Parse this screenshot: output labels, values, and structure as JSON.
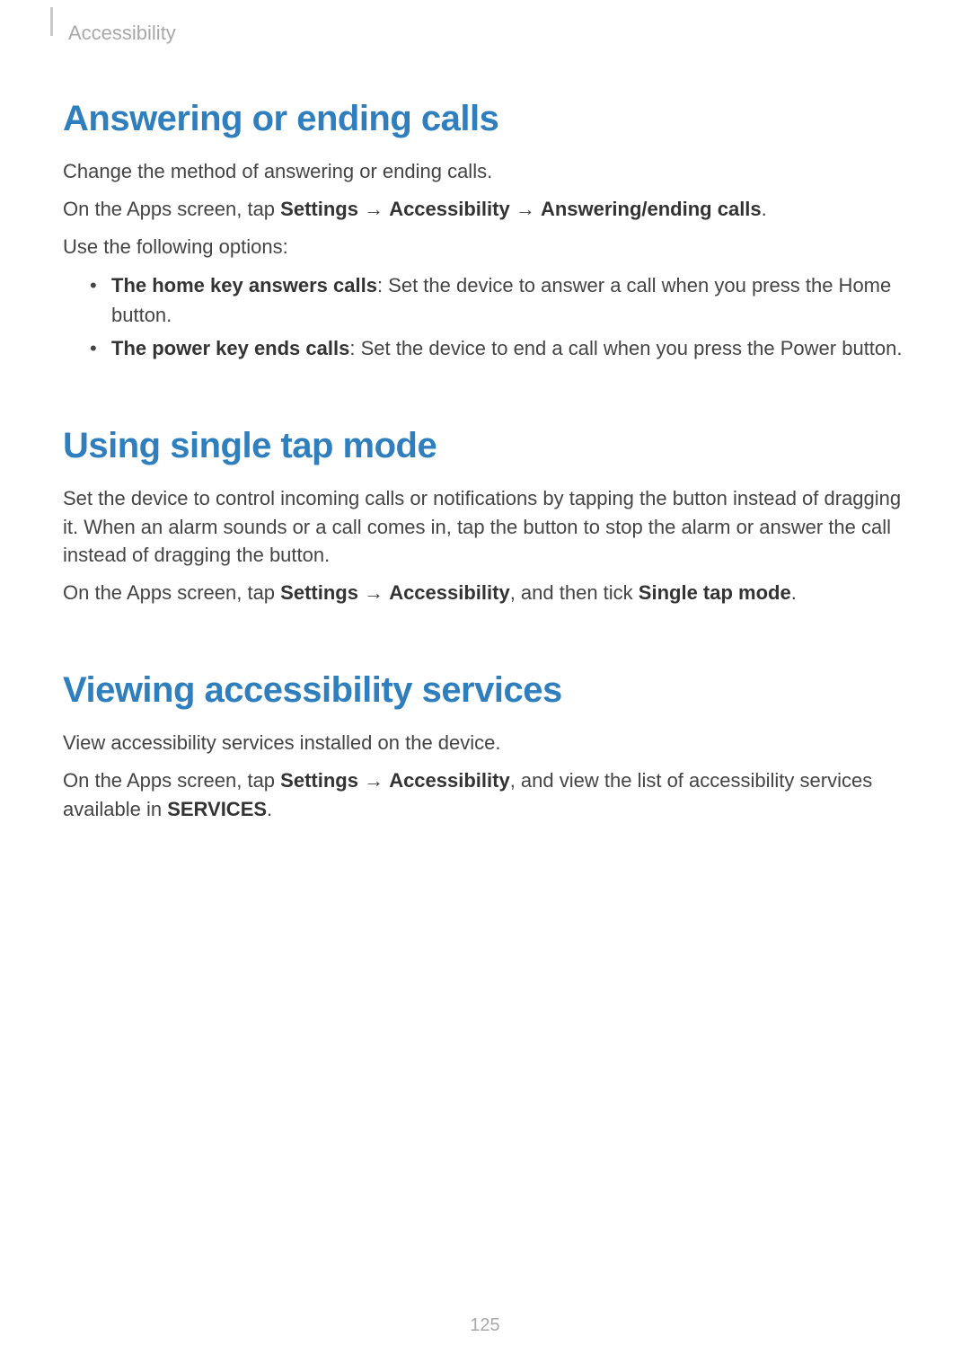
{
  "breadcrumb": "Accessibility",
  "sections": {
    "s1": {
      "title": "Answering or ending calls",
      "p1": "Change the method of answering or ending calls.",
      "p2_pre": "On the Apps screen, tap ",
      "p2_path1": "Settings",
      "p2_arrow1": " → ",
      "p2_path2": "Accessibility",
      "p2_arrow2": " → ",
      "p2_path3": "Answering/ending calls",
      "p2_post": ".",
      "p3": "Use the following options:",
      "bullet1_bold": "The home key answers calls",
      "bullet1_rest": ": Set the device to answer a call when you press the Home button.",
      "bullet2_bold": "The power key ends calls",
      "bullet2_rest": ": Set the device to end a call when you press the Power button."
    },
    "s2": {
      "title": "Using single tap mode",
      "p1": "Set the device to control incoming calls or notifications by tapping the button instead of dragging it. When an alarm sounds or a call comes in, tap the button to stop the alarm or answer the call instead of dragging the button.",
      "p2_pre": "On the Apps screen, tap ",
      "p2_path1": "Settings",
      "p2_arrow1": " → ",
      "p2_path2": "Accessibility",
      "p2_mid": ", and then tick ",
      "p2_path3": "Single tap mode",
      "p2_post": "."
    },
    "s3": {
      "title": "Viewing accessibility services",
      "p1": "View accessibility services installed on the device.",
      "p2_pre": "On the Apps screen, tap ",
      "p2_path1": "Settings",
      "p2_arrow1": " → ",
      "p2_path2": "Accessibility",
      "p2_mid": ", and view the list of accessibility services available in ",
      "p2_path3": "SERVICES",
      "p2_post": "."
    }
  },
  "page_number": "125"
}
